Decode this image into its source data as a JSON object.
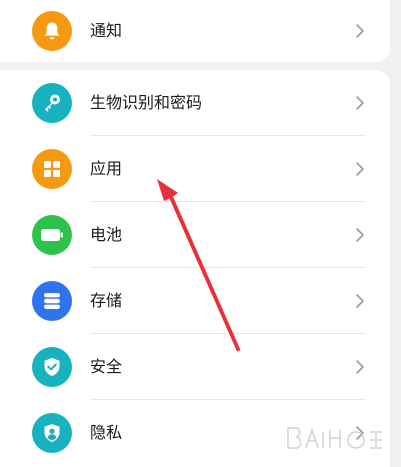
{
  "settings": {
    "top_item": {
      "label": "通知",
      "icon": "bell-icon",
      "color": "#f59a10"
    },
    "items": [
      {
        "label": "生物识别和密码",
        "icon": "key-icon",
        "color": "#18b2bf"
      },
      {
        "label": "应用",
        "icon": "apps-grid-icon",
        "color": "#f59a10"
      },
      {
        "label": "电池",
        "icon": "battery-icon",
        "color": "#2fc24a"
      },
      {
        "label": "存储",
        "icon": "storage-icon",
        "color": "#2f73ee"
      },
      {
        "label": "安全",
        "icon": "shield-check-icon",
        "color": "#18b2bf"
      },
      {
        "label": "隐私",
        "icon": "privacy-shield-icon",
        "color": "#18b2bf"
      }
    ]
  },
  "annotation": {
    "arrow_color": "#e8303a"
  }
}
